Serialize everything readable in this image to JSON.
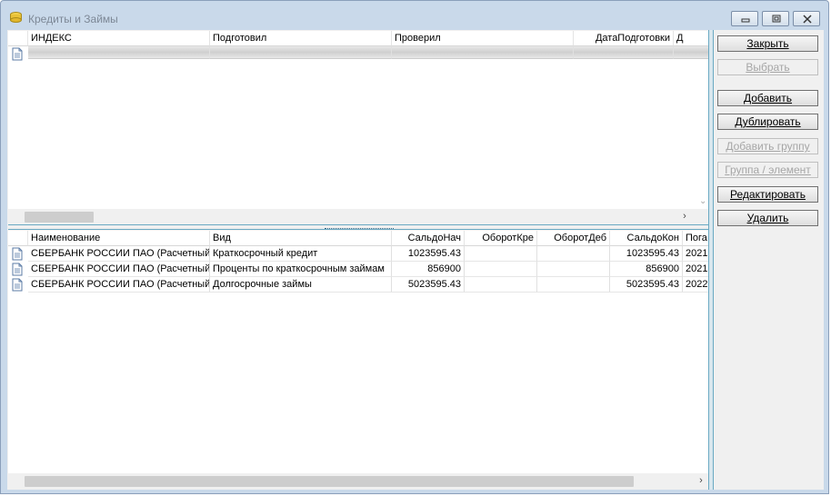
{
  "window": {
    "title": "Кредиты и Займы",
    "icons": {
      "app": "money-stack-icon",
      "minimize": "minimize-icon",
      "maximize": "maximize-icon",
      "close": "close-icon"
    }
  },
  "top_grid": {
    "columns": [
      "ИНДЕКС",
      "Подготовил",
      "Проверил",
      "ДатаПодготовки",
      "Д"
    ],
    "rows": []
  },
  "bottom_grid": {
    "columns": [
      "Наименование",
      "Вид",
      "СальдоНач",
      "ОборотКре",
      "ОборотДеб",
      "СальдоКон",
      "Пога"
    ],
    "rows": [
      [
        "СБЕРБАНК РОССИИ ПАО (Расчетный)",
        "Краткосрочный кредит",
        "1023595.43",
        "",
        "",
        "1023595.43",
        "2021"
      ],
      [
        "СБЕРБАНК РОССИИ ПАО (Расчетный)",
        "Проценты по краткосрочным займам",
        "856900",
        "",
        "",
        "856900",
        "2021"
      ],
      [
        "СБЕРБАНК РОССИИ ПАО (Расчетный)",
        "Долгосрочные займы",
        "5023595.43",
        "",
        "",
        "5023595.43",
        "2022"
      ]
    ]
  },
  "buttons": {
    "close": "Закрыть",
    "select": "Выбрать",
    "add": "Добавить",
    "duplicate": "Дублировать",
    "add_group": "Добавить группу",
    "group_element": "Группа / элемент",
    "edit": "Редактировать",
    "delete": "Удалить"
  },
  "colors": {
    "accent": "#6aa9c3",
    "frame": "#c9d9ea",
    "disabled_text": "#a6a6a6"
  }
}
